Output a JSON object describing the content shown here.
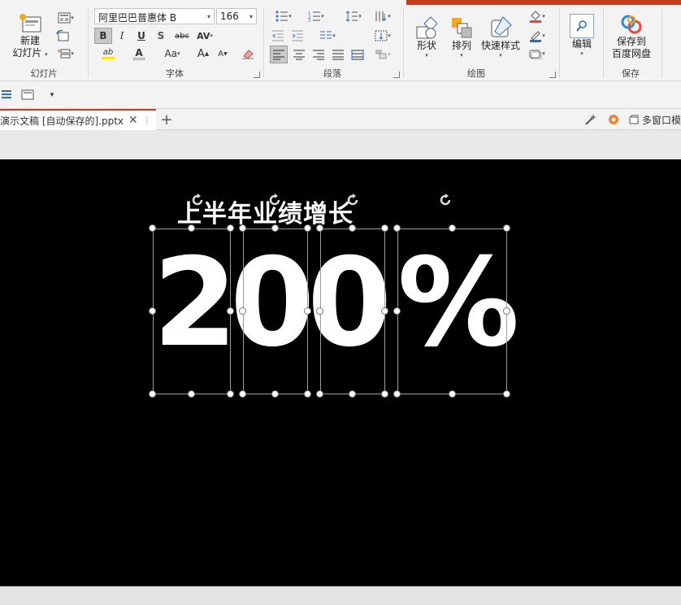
{
  "ribbon": {
    "slides_group": {
      "label": "幻灯片",
      "new_slide_label_1": "新建",
      "new_slide_label_2": "幻灯片"
    },
    "font_group": {
      "label": "字体",
      "font_name": "阿里巴巴普惠体 B",
      "font_size": "166",
      "bold": "B",
      "italic": "I",
      "underline": "U",
      "shadow": "S",
      "strike": "abc",
      "spacing": "AV",
      "highlight": "ab",
      "font_color": "A",
      "change_case": "Aa",
      "grow": "A",
      "shrink": "A"
    },
    "paragraph_group": {
      "label": "段落"
    },
    "drawing_group": {
      "label": "绘图",
      "shapes": "形状",
      "arrange": "排列",
      "quick_styles": "快速样式"
    },
    "editing_group": {
      "label": "",
      "edit": "编辑"
    },
    "save_group": {
      "label": "保存",
      "save_to_1": "保存到",
      "save_to_2": "百度网盘"
    }
  },
  "tabs": {
    "document_tab": "演示文稿 [自动保存的].pptx",
    "add_tab": "+",
    "multi_window": "多窗口模"
  },
  "slide": {
    "title": "上半年业绩增长",
    "chars": [
      "2",
      "0",
      "0",
      "%"
    ]
  },
  "colors": {
    "accent": "#c43e1c",
    "slide_bg": "#000000",
    "ribbon_bg": "#f3f3f3"
  }
}
